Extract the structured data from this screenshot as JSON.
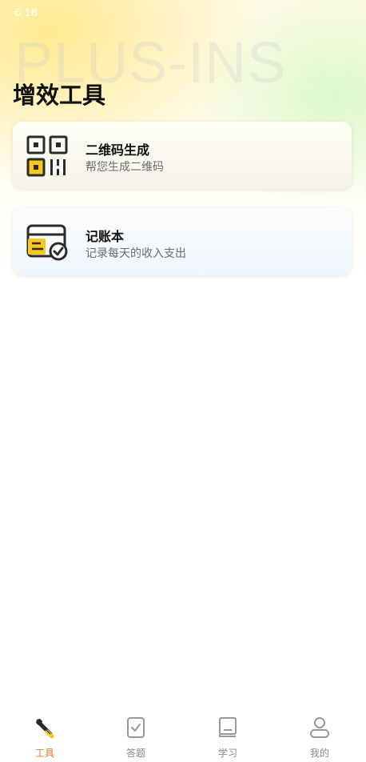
{
  "status_bar": {
    "time": "6:18"
  },
  "watermark": "PLUS-INS",
  "page": {
    "title": "增效工具"
  },
  "tools": [
    {
      "title": "二维码生成",
      "subtitle": "帮您生成二维码",
      "icon": "qr-code-icon"
    },
    {
      "title": "记账本",
      "subtitle": "记录每天的收入支出",
      "icon": "ledger-icon"
    }
  ],
  "tabbar": {
    "items": [
      {
        "label": "工具",
        "icon": "wrench-icon",
        "active": true
      },
      {
        "label": "答题",
        "icon": "clipboard-check-icon",
        "active": false
      },
      {
        "label": "学习",
        "icon": "book-icon",
        "active": false
      },
      {
        "label": "我的",
        "icon": "user-icon",
        "active": false
      }
    ]
  },
  "colors": {
    "accent": "#e07a2f",
    "yellow": "#f7c81e",
    "icon_dark": "#2b2b2b",
    "tab_inactive": "#888888"
  }
}
